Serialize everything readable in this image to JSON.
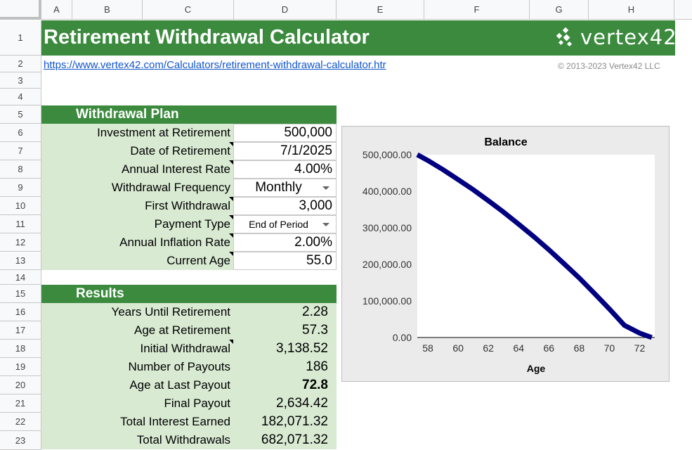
{
  "columns": [
    "A",
    "B",
    "C",
    "D",
    "E",
    "F",
    "G",
    "H"
  ],
  "rows": [
    "1",
    "2",
    "3",
    "4",
    "5",
    "6",
    "7",
    "8",
    "9",
    "10",
    "11",
    "12",
    "13",
    "14",
    "15",
    "16",
    "17",
    "18",
    "19",
    "20",
    "21",
    "22",
    "23"
  ],
  "title": "Retirement Withdrawal Calculator",
  "logo_text": "vertex42",
  "url": "https://www.vertex42.com/Calculators/retirement-withdrawal-calculator.htr",
  "copyright": "© 2013-2023 Vertex42 LLC",
  "plan": {
    "header": "Withdrawal Plan",
    "rows": [
      {
        "label": "Investment at Retirement",
        "value": "500,000"
      },
      {
        "label": "Date of Retirement",
        "value": "7/1/2025"
      },
      {
        "label": "Annual Interest Rate",
        "value": "4.00%"
      },
      {
        "label": "Withdrawal Frequency",
        "value": "Monthly"
      },
      {
        "label": "First Withdrawal",
        "value": "3,000"
      },
      {
        "label": "Payment Type",
        "value": "End of Period"
      },
      {
        "label": "Annual Inflation Rate",
        "value": "2.00%"
      },
      {
        "label": "Current Age",
        "value": "55.0"
      }
    ]
  },
  "results": {
    "header": "Results",
    "rows": [
      {
        "label": "Years Until Retirement",
        "value": "2.28"
      },
      {
        "label": "Age at Retirement",
        "value": "57.3"
      },
      {
        "label": "Initial Withdrawal",
        "value": "3,138.52"
      },
      {
        "label": "Number of Payouts",
        "value": "186"
      },
      {
        "label": "Age at Last Payout",
        "value": "72.8"
      },
      {
        "label": "Final Payout",
        "value": "2,634.42"
      },
      {
        "label": "Total Interest Earned",
        "value": "182,071.32"
      },
      {
        "label": "Total Withdrawals",
        "value": "682,071.32"
      }
    ]
  },
  "colors": {
    "green": "#3b8a3e",
    "light_green": "#d9ead3",
    "line": "#000080",
    "link": "#1155cc"
  },
  "chart_data": {
    "type": "line",
    "title": "Balance",
    "xlabel": "Age",
    "ylabel": "",
    "xlim": [
      57.3,
      73
    ],
    "ylim": [
      0,
      500000
    ],
    "xticks": [
      "58",
      "60",
      "62",
      "64",
      "66",
      "68",
      "70",
      "72"
    ],
    "xtick_values": [
      58,
      60,
      62,
      64,
      66,
      68,
      70,
      72
    ],
    "yticks": [
      "500,000.00",
      "400,000.00",
      "300,000.00",
      "200,000.00",
      "100,000.00",
      "0.00"
    ],
    "ytick_values": [
      500000,
      400000,
      300000,
      200000,
      100000,
      0
    ],
    "grid": false,
    "series": [
      {
        "name": "",
        "x": [
          57.3,
          58,
          59,
          60,
          61,
          62,
          63,
          64,
          65,
          66,
          67,
          68,
          69,
          70,
          71,
          72,
          72.8
        ],
        "y": [
          500000,
          484000,
          459000,
          432000,
          404000,
          374000,
          343000,
          310000,
          276000,
          240000,
          202000,
          163000,
          121000,
          78000,
          33000,
          12000,
          0
        ]
      }
    ]
  }
}
